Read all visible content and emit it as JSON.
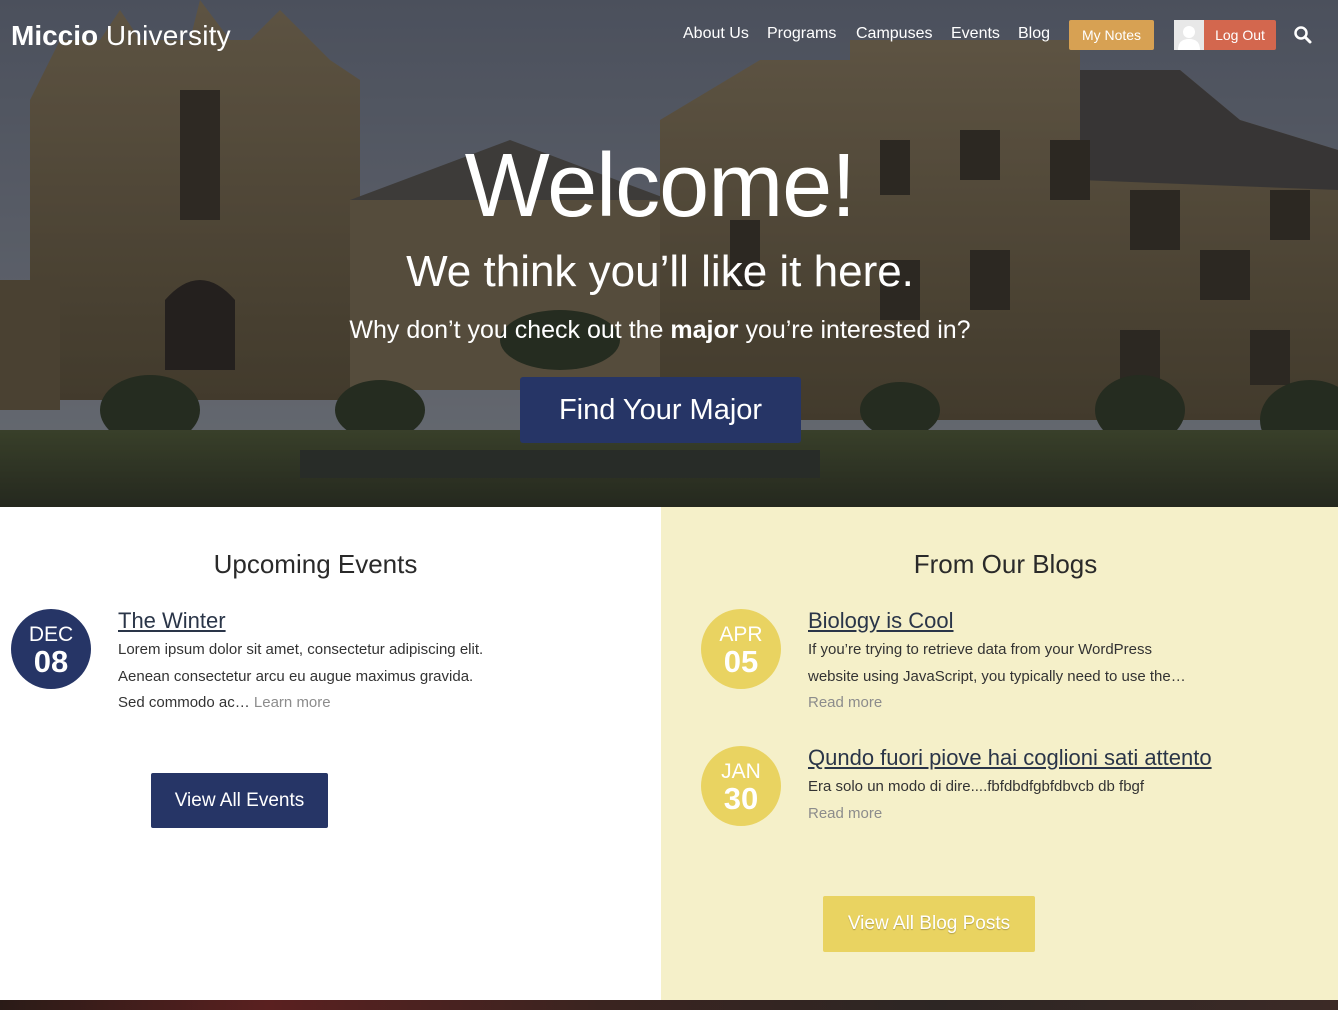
{
  "header": {
    "logo_bold": "Miccio",
    "logo_light": "University",
    "nav": [
      "About Us",
      "Programs",
      "Campuses",
      "Events",
      "Blog"
    ],
    "my_notes_label": "My Notes",
    "logout_label": "Log Out",
    "search_icon": "search-icon"
  },
  "hero": {
    "title": "Welcome!",
    "subtitle": "We think you’ll like it here.",
    "text_before": "Why don’t you check out the ",
    "text_bold": "major",
    "text_after": " you’re interested in?",
    "cta_label": "Find Your Major"
  },
  "events": {
    "heading": "Upcoming Events",
    "items": [
      {
        "month": "DEC",
        "day": "08",
        "title": "The Winter",
        "excerpt": "Lorem ipsum dolor sit amet, consectetur adipiscing elit. Aenean consectetur arcu eu augue maximus gravida. Sed commodo ac…",
        "more": "Learn more"
      }
    ],
    "button_label": "View All Events"
  },
  "blogs": {
    "heading": "From Our Blogs",
    "items": [
      {
        "month": "APR",
        "day": "05",
        "title": "Biology is Cool",
        "excerpt": "If you’re trying to retrieve data from your WordPress website using JavaScript, you typically need to use the…",
        "more": "Read more"
      },
      {
        "month": "JAN",
        "day": "30",
        "title": "Qundo fuori piove hai coglioni sati attento",
        "excerpt": "Era solo un modo di dire....fbfdbdfgbfdbvcb db fbgf",
        "more": "Read more"
      }
    ],
    "button_label": "View All Blog Posts"
  },
  "colors": {
    "navy": "#263566",
    "yellow": "#e9d361",
    "cream": "#f5f0c9",
    "orange": "#d7a153",
    "red": "#d3674e"
  }
}
